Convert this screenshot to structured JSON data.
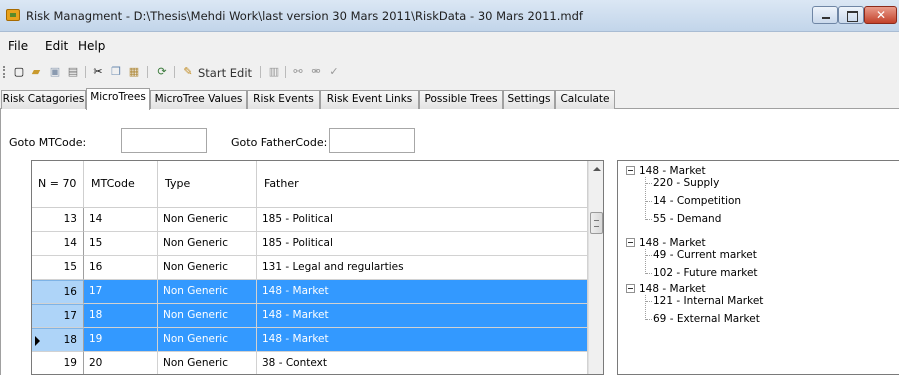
{
  "window": {
    "title": "Risk Managment - D:\\Thesis\\Mehdi Work\\last version 30 Mars 2011\\RiskData - 30 Mars 2011.mdf"
  },
  "menu": [
    "File",
    "Edit",
    "Help"
  ],
  "toolbar": {
    "start_edit": "Start Edit"
  },
  "tabs": [
    "Risk Catagories",
    "MicroTrees",
    "MicroTree Values",
    "Risk Events",
    "Risk Event Links",
    "Possible Trees",
    "Settings",
    "Calculate"
  ],
  "active_tab": "MicroTrees",
  "goto": {
    "mtcode_label": "Goto MTCode:",
    "mtcode_value": "",
    "fathercode_label": "Goto FatherCode:",
    "fathercode_value": ""
  },
  "grid": {
    "columns": [
      "N = 70",
      "MTCode",
      "Type",
      "Father"
    ],
    "rows": [
      {
        "n": "13",
        "mtcode": "14",
        "type": "Non Generic",
        "father": "185 - Political",
        "selected": false
      },
      {
        "n": "14",
        "mtcode": "15",
        "type": "Non Generic",
        "father": "185 - Political",
        "selected": false
      },
      {
        "n": "15",
        "mtcode": "16",
        "type": "Non Generic",
        "father": "131 - Legal and regularties",
        "selected": false
      },
      {
        "n": "16",
        "mtcode": "17",
        "type": "Non Generic",
        "father": "148 - Market",
        "selected": true
      },
      {
        "n": "17",
        "mtcode": "18",
        "type": "Non Generic",
        "father": "148 - Market",
        "selected": true
      },
      {
        "n": "18",
        "mtcode": "19",
        "type": "Non Generic",
        "father": "148 - Market",
        "selected": true,
        "current": true
      },
      {
        "n": "19",
        "mtcode": "20",
        "type": "Non Generic",
        "father": "38 - Context",
        "selected": false
      }
    ]
  },
  "tree": [
    {
      "label": "148 - Market",
      "children": [
        "220 - Supply",
        "14 - Competition",
        "55 - Demand"
      ]
    },
    {
      "label": "148 - Market",
      "children": [
        "49 - Current market",
        "102 - Future market"
      ]
    },
    {
      "label": "148 - Market",
      "children": [
        "121 - Internal Market",
        "69 - External Market"
      ]
    }
  ],
  "colors": {
    "selection": "#3399ff",
    "row_header_selected": "#aed4f8"
  },
  "icons": [
    "new-icon",
    "open-icon",
    "save-icon",
    "print-icon",
    "cut-icon",
    "copy-icon",
    "paste-icon",
    "refresh-icon",
    "pencil-icon",
    "grid-icon",
    "link-icon",
    "unlink-icon",
    "check-icon"
  ]
}
